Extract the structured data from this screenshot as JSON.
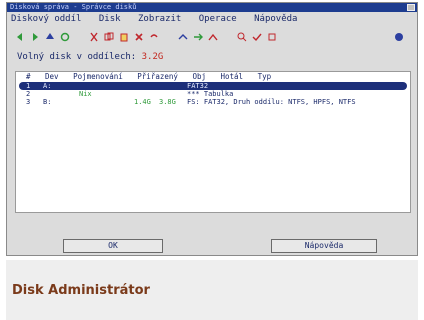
{
  "window": {
    "title": "Disková správa - Správce disků"
  },
  "menu": {
    "items": [
      "Diskový oddíl",
      "Disk",
      "Zobrazit",
      "Operace",
      "Nápověda"
    ]
  },
  "toolbar": {
    "groups": [
      [
        "back-icon",
        "forward-icon",
        "up-icon",
        "refresh-icon"
      ],
      [
        "cut-icon",
        "copy-icon",
        "paste-icon",
        "delete-icon",
        "undo-icon"
      ],
      [
        "format-icon",
        "partition-icon",
        "merge-icon"
      ],
      [
        "scan-icon",
        "check-icon",
        "info-icon"
      ]
    ],
    "help_icon": "help-icon",
    "colors": {
      "green": "#2f9a3a",
      "red": "#c0272d",
      "blue": "#2c3fa0"
    }
  },
  "info": {
    "label": "Volný disk v oddílech:",
    "value": "3.2G"
  },
  "table": {
    "headers": [
      "#",
      "Dev",
      "Pojmenování",
      "Přiřazený",
      "Obj",
      "Hotál",
      "Typ"
    ],
    "rows": [
      {
        "num": "1",
        "dev": "A:",
        "col3": "",
        "size1": "",
        "size2": "",
        "type": "FAT32",
        "selected": true
      },
      {
        "num": "2",
        "dev": "",
        "col3": "Nix",
        "size1": "",
        "size2": "",
        "type": "*** Tabulka",
        "selected": false
      },
      {
        "num": "3",
        "dev": "B:",
        "col3": "",
        "size1": "1.4G",
        "size2": "3.8G",
        "type": "FS: FAT32, Druh oddílu: NTFS, HPFS, NTFS",
        "selected": false
      }
    ]
  },
  "buttons": {
    "ok": "OK",
    "help": "Nápověda"
  },
  "caption": {
    "text": "Disk Administrátor"
  }
}
